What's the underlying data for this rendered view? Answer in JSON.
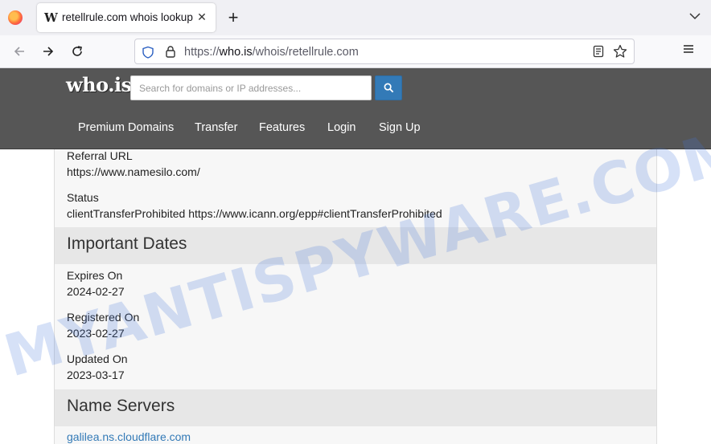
{
  "browser": {
    "tab_title": "retellrule.com whois lookup",
    "tab_icon_glyph": "W",
    "new_tab_glyph": "+",
    "close_glyph": "✕",
    "url_scheme": "https://",
    "url_host": "who.is",
    "url_path": "/whois/retellrule.com"
  },
  "site": {
    "logo": "who.is",
    "search_placeholder": "Search for domains or IP addresses...",
    "nav": [
      "Premium Domains",
      "Transfer",
      "Features",
      "Login",
      "Sign Up"
    ]
  },
  "content": {
    "referral_label": "Referral URL",
    "referral_value": "https://www.namesilo.com/",
    "status_label": "Status",
    "status_value": "clientTransferProhibited https://www.icann.org/epp#clientTransferProhibited",
    "dates_heading": "Important Dates",
    "expires_label": "Expires On",
    "expires_value": "2024-02-27",
    "registered_label": "Registered On",
    "registered_value": "2023-02-27",
    "updated_label": "Updated On",
    "updated_value": "2023-03-17",
    "ns_heading": "Name Servers",
    "ns_1": "galilea.ns.cloudflare.com"
  },
  "watermark": "MYANTISPYWARE.COM",
  "colors": {
    "header_bg": "#565656",
    "accent_blue": "#337ab7",
    "section_bg": "#e7e7e7"
  }
}
